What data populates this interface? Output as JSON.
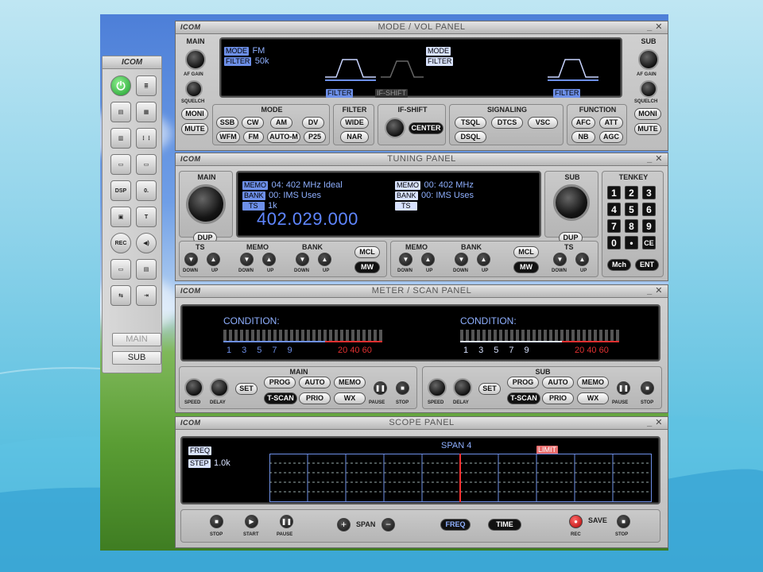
{
  "launcher": {
    "title": "ICOM",
    "main_label": "MAIN",
    "sub_label": "SUB"
  },
  "mode_panel": {
    "title": "MODE / VOL PANEL",
    "brand": "ICOM",
    "main_label": "MAIN",
    "sub_label": "SUB",
    "af_gain": "AF GAIN",
    "squelch": "SQUELCH",
    "mode_tag": "MODE",
    "mode_value": "FM",
    "filter_tag": "FILTER",
    "filter_value": "50k",
    "filter_graph_label": "FILTER",
    "ifshift_graph_label": "IF-SHIFT",
    "sub_mode_tag": "MODE",
    "sub_filter_tag": "FILTER",
    "sub_filter_graph_label": "FILTER",
    "moni": "MONI",
    "mute": "MUTE",
    "mode_group": "MODE",
    "filter_group": "FILTER",
    "ifshift_group": "IF-SHIFT",
    "signaling_group": "SIGNALING",
    "function_group": "FUNCTION",
    "modes_row1": [
      "SSB",
      "CW",
      "AM",
      "DV"
    ],
    "modes_row2": [
      "WFM",
      "FM",
      "AUTO-M",
      "P25"
    ],
    "filters": [
      "WIDE",
      "NAR"
    ],
    "center": "CENTER",
    "signaling_row1": [
      "TSQL",
      "DTCS",
      "VSC"
    ],
    "signaling_row2": [
      "DSQL"
    ],
    "function_row1": [
      "AFC",
      "ATT"
    ],
    "function_row2": [
      "NB",
      "AGC"
    ]
  },
  "tuning_panel": {
    "title": "TUNING PANEL",
    "brand": "ICOM",
    "main_label": "MAIN",
    "sub_label": "SUB",
    "tenkey_label": "TENKEY",
    "dup": "DUP",
    "main_memo_tag": "MEMO",
    "main_memo_value": "04: 402 MHz Ideal",
    "main_bank_tag": "BANK",
    "main_bank_value": "00: IMS Uses",
    "main_ts_tag": "TS",
    "main_ts_value": "1k",
    "frequency": "402.029.000",
    "sub_memo_tag": "MEMO",
    "sub_memo_value": "00: 402 MHz",
    "sub_bank_tag": "BANK",
    "sub_bank_value": "00: IMS Uses",
    "sub_ts_tag": "TS",
    "ts": "TS",
    "memo": "MEMO",
    "bank": "BANK",
    "mcl": "MCL",
    "mw": "MW",
    "down": "DOWN",
    "up": "UP",
    "keys": [
      "1",
      "2",
      "3",
      "4",
      "5",
      "6",
      "7",
      "8",
      "9",
      "0",
      "•",
      "CE"
    ],
    "mch": "Mch",
    "ent": "ENT"
  },
  "meter_panel": {
    "title": "METER / SCAN PANEL",
    "brand": "ICOM",
    "condition_left": "CONDITION:",
    "condition_right": "CONDITION:",
    "scale_blue": [
      "1",
      "3",
      "5",
      "7",
      "9"
    ],
    "scale_red": [
      "20",
      "40",
      "60"
    ],
    "main_group": "MAIN",
    "sub_group": "SUB",
    "speed": "SPEED",
    "delay": "DELAY",
    "set": "SET",
    "prog": "PROG",
    "auto": "AUTO",
    "memo": "MEMO",
    "tscan": "T-SCAN",
    "prio": "PRIO",
    "wx": "WX",
    "pause": "PAUSE",
    "stop": "STOP"
  },
  "scope_panel": {
    "title": "SCOPE PANEL",
    "brand": "ICOM",
    "freq_tag": "FREQ",
    "step_tag": "STEP",
    "step_value": "1.0k",
    "span_label": "SPAN 4",
    "limit_label": "LIMIT",
    "stop": "STOP",
    "start": "START",
    "pause": "PAUSE",
    "span": "SPAN",
    "freq_btn": "FREQ",
    "time_btn": "TIME",
    "rec": "REC",
    "save": "SAVE",
    "save_stop": "STOP"
  },
  "colors": {
    "lcd_text": "#8fb0ff",
    "frequency": "#5f86ff",
    "meter_red": "#e03030",
    "scope_marker": "#ff3030"
  }
}
